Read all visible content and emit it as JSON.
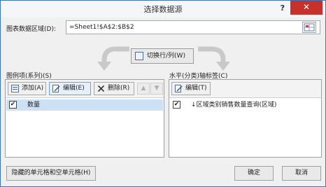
{
  "window": {
    "title": "选择数据源",
    "help": "?",
    "close": "✕"
  },
  "range": {
    "label": "图表数据区域(D):",
    "value": "=Sheet1!$A$2:$B$2"
  },
  "switch_label": "切换行/列(W)",
  "legend": {
    "header": "图例项(系列)(S)",
    "add": "添加(A)",
    "edit": "编辑(E)",
    "remove": "删除(R)",
    "up": "▲",
    "down": "▼",
    "items": [
      {
        "label": "数量",
        "checked": "✔"
      }
    ]
  },
  "axis": {
    "header": "水平(分类)轴标签(C)",
    "edit": "编辑(T)",
    "items": [
      {
        "label": "↓区域类别销售数量查询(区域)",
        "checked": "✔"
      }
    ]
  },
  "buttons": {
    "hidden_cells": "隐藏的单元格和空单元格(H)",
    "ok": "确定",
    "cancel": "取消"
  }
}
